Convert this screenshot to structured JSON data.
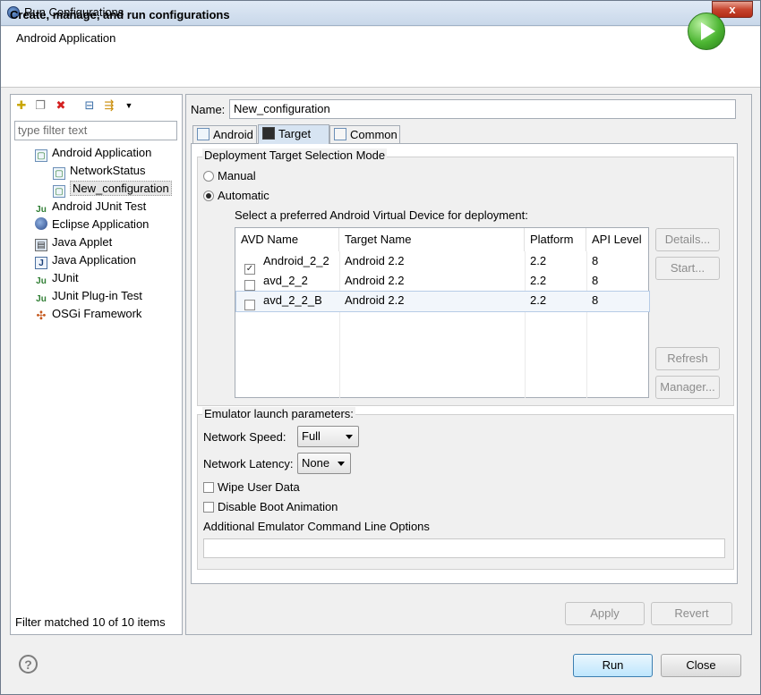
{
  "window": {
    "title": "Run Configurations",
    "close_label": "x"
  },
  "header": {
    "title": "Create, manage, and run configurations",
    "subtitle": "Android Application",
    "icon": "run-icon"
  },
  "left": {
    "toolbar_icons": [
      "new-config-icon",
      "duplicate-icon",
      "delete-icon",
      "collapse-all-icon",
      "filter-icon",
      "dropdown-arrow-icon"
    ],
    "filter_placeholder": "type filter text",
    "tree": [
      {
        "label": "Android Application",
        "icon": "android-app-icon",
        "level": 0
      },
      {
        "label": "NetworkStatus",
        "icon": "config-icon",
        "level": 1
      },
      {
        "label": "New_configuration",
        "icon": "config-icon",
        "level": 1,
        "selected": true
      },
      {
        "label": "Android JUnit Test",
        "icon": "junit-icon",
        "level": 0
      },
      {
        "label": "Eclipse Application",
        "icon": "eclipse-icon",
        "level": 0
      },
      {
        "label": "Java Applet",
        "icon": "applet-icon",
        "level": 0
      },
      {
        "label": "Java Application",
        "icon": "java-app-icon",
        "level": 0
      },
      {
        "label": "JUnit",
        "icon": "junit-icon",
        "level": 0
      },
      {
        "label": "JUnit Plug-in Test",
        "icon": "junit-plugin-icon",
        "level": 0
      },
      {
        "label": "OSGi Framework",
        "icon": "osgi-icon",
        "level": 0
      }
    ],
    "status": "Filter matched 10 of 10 items"
  },
  "main": {
    "name_label": "Name:",
    "name_value": "New_configuration",
    "tabs": [
      {
        "label": "Android",
        "icon": "android-tab-icon"
      },
      {
        "label": "Target",
        "icon": "target-tab-icon",
        "active": true
      },
      {
        "label": "Common",
        "icon": "common-tab-icon"
      }
    ],
    "deployment": {
      "title": "Deployment Target Selection Mode",
      "manual": "Manual",
      "automatic": "Automatic",
      "selected_mode": "Automatic",
      "avd_prompt": "Select a preferred Android Virtual Device for deployment:",
      "columns": [
        "AVD Name",
        "Target Name",
        "Platform",
        "API Level"
      ],
      "rows": [
        {
          "checked": true,
          "name": "Android_2_2",
          "target": "Android 2.2",
          "platform": "2.2",
          "api": "8"
        },
        {
          "checked": false,
          "name": "avd_2_2",
          "target": "Android 2.2",
          "platform": "2.2",
          "api": "8"
        },
        {
          "checked": false,
          "name": "avd_2_2_B",
          "target": "Android 2.2",
          "platform": "2.2",
          "api": "8"
        }
      ],
      "buttons": {
        "details": "Details...",
        "start": "Start...",
        "refresh": "Refresh",
        "manager": "Manager..."
      }
    },
    "emulator": {
      "title": "Emulator launch parameters:",
      "speed_label": "Network Speed:",
      "speed_value": "Full",
      "latency_label": "Network Latency:",
      "latency_value": "None",
      "wipe_label": "Wipe User Data",
      "boot_label": "Disable Boot Animation",
      "options_label": "Additional Emulator Command Line Options",
      "options_value": ""
    },
    "apply": "Apply",
    "revert": "Revert"
  },
  "footer": {
    "help_icon": "?",
    "run": "Run",
    "close": "Close"
  },
  "colors": {
    "accent": "#3c7fb1",
    "header_bg": "#ffffff",
    "dialog_bg": "#f0f0f0",
    "run_green": "#4cb532"
  }
}
